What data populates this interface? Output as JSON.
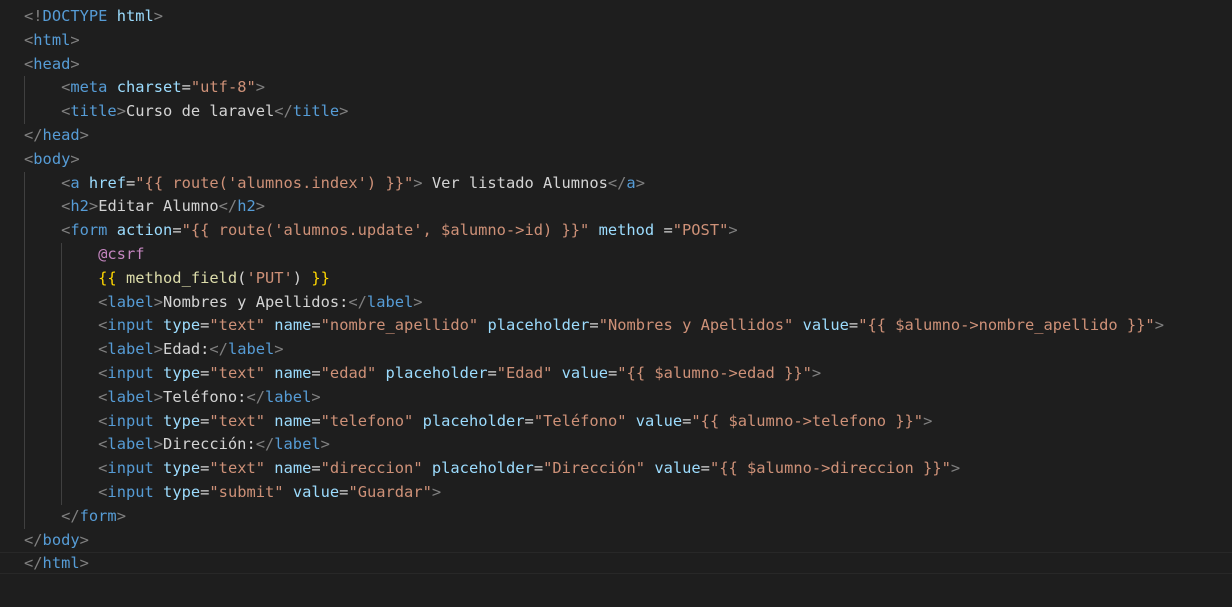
{
  "editor": {
    "background": "#1e1e1e",
    "colors": {
      "punct": "#808080",
      "tag": "#569cd6",
      "attr": "#9cdcfe",
      "string": "#ce9178",
      "text": "#d4d4d4",
      "blade": "#c586c0",
      "brace": "#ffd700",
      "func": "#dcdcaa"
    },
    "lines": [
      {
        "indent": 0,
        "tokens": [
          [
            "punct",
            "<!"
          ],
          [
            "tag",
            "DOCTYPE"
          ],
          [
            "text",
            " "
          ],
          [
            "attr",
            "html"
          ],
          [
            "punct",
            ">"
          ]
        ]
      },
      {
        "indent": 0,
        "tokens": [
          [
            "punct",
            "<"
          ],
          [
            "tag",
            "html"
          ],
          [
            "punct",
            ">"
          ]
        ]
      },
      {
        "indent": 0,
        "tokens": [
          [
            "punct",
            "<"
          ],
          [
            "tag",
            "head"
          ],
          [
            "punct",
            ">"
          ]
        ]
      },
      {
        "indent": 1,
        "tokens": [
          [
            "punct",
            "<"
          ],
          [
            "tag",
            "meta"
          ],
          [
            "text",
            " "
          ],
          [
            "attr",
            "charset"
          ],
          [
            "text",
            "="
          ],
          [
            "str",
            "\"utf-8\""
          ],
          [
            "punct",
            ">"
          ]
        ]
      },
      {
        "indent": 1,
        "tokens": [
          [
            "punct",
            "<"
          ],
          [
            "tag",
            "title"
          ],
          [
            "punct",
            ">"
          ],
          [
            "text",
            "Curso de laravel"
          ],
          [
            "punct",
            "</"
          ],
          [
            "tag",
            "title"
          ],
          [
            "punct",
            ">"
          ]
        ]
      },
      {
        "indent": 0,
        "tokens": [
          [
            "punct",
            "</"
          ],
          [
            "tag",
            "head"
          ],
          [
            "punct",
            ">"
          ]
        ]
      },
      {
        "indent": 0,
        "tokens": [
          [
            "punct",
            "<"
          ],
          [
            "tag",
            "body"
          ],
          [
            "punct",
            ">"
          ]
        ]
      },
      {
        "indent": 1,
        "tokens": [
          [
            "punct",
            "<"
          ],
          [
            "tag",
            "a"
          ],
          [
            "text",
            " "
          ],
          [
            "attr",
            "href"
          ],
          [
            "text",
            "="
          ],
          [
            "str",
            "\"{{ route('alumnos.index') }}\""
          ],
          [
            "punct",
            ">"
          ],
          [
            "text",
            " Ver listado Alumnos"
          ],
          [
            "punct",
            "</"
          ],
          [
            "tag",
            "a"
          ],
          [
            "punct",
            ">"
          ]
        ]
      },
      {
        "indent": 1,
        "tokens": [
          [
            "punct",
            "<"
          ],
          [
            "tag",
            "h2"
          ],
          [
            "punct",
            ">"
          ],
          [
            "text",
            "Editar Alumno"
          ],
          [
            "punct",
            "</"
          ],
          [
            "tag",
            "h2"
          ],
          [
            "punct",
            ">"
          ]
        ]
      },
      {
        "indent": 1,
        "tokens": [
          [
            "punct",
            "<"
          ],
          [
            "tag",
            "form"
          ],
          [
            "text",
            " "
          ],
          [
            "attr",
            "action"
          ],
          [
            "text",
            "="
          ],
          [
            "str",
            "\"{{ route('alumnos.update', $alumno->id) }}\""
          ],
          [
            "text",
            " "
          ],
          [
            "attr",
            "method"
          ],
          [
            "text",
            " ="
          ],
          [
            "str",
            "\"POST\""
          ],
          [
            "punct",
            ">"
          ]
        ]
      },
      {
        "indent": 2,
        "tokens": [
          [
            "blade",
            "@csrf"
          ]
        ]
      },
      {
        "indent": 2,
        "tokens": [
          [
            "brace",
            "{{"
          ],
          [
            "text",
            " "
          ],
          [
            "func",
            "method_field"
          ],
          [
            "text",
            "("
          ],
          [
            "str",
            "'PUT'"
          ],
          [
            "text",
            ") "
          ],
          [
            "brace",
            "}}"
          ]
        ]
      },
      {
        "indent": 2,
        "tokens": [
          [
            "punct",
            "<"
          ],
          [
            "tag",
            "label"
          ],
          [
            "punct",
            ">"
          ],
          [
            "text",
            "Nombres y Apellidos:"
          ],
          [
            "punct",
            "</"
          ],
          [
            "tag",
            "label"
          ],
          [
            "punct",
            ">"
          ]
        ]
      },
      {
        "indent": 2,
        "tokens": [
          [
            "punct",
            "<"
          ],
          [
            "tag",
            "input"
          ],
          [
            "text",
            " "
          ],
          [
            "attr",
            "type"
          ],
          [
            "text",
            "="
          ],
          [
            "str",
            "\"text\""
          ],
          [
            "text",
            " "
          ],
          [
            "attr",
            "name"
          ],
          [
            "text",
            "="
          ],
          [
            "str",
            "\"nombre_apellido\""
          ],
          [
            "text",
            " "
          ],
          [
            "attr",
            "placeholder"
          ],
          [
            "text",
            "="
          ],
          [
            "str",
            "\"Nombres y Apellidos\""
          ],
          [
            "text",
            " "
          ],
          [
            "attr",
            "value"
          ],
          [
            "text",
            "="
          ],
          [
            "str",
            "\"{{ $alumno->nombre_apellido }}\""
          ],
          [
            "punct",
            ">"
          ]
        ]
      },
      {
        "indent": 2,
        "tokens": [
          [
            "punct",
            "<"
          ],
          [
            "tag",
            "label"
          ],
          [
            "punct",
            ">"
          ],
          [
            "text",
            "Edad:"
          ],
          [
            "punct",
            "</"
          ],
          [
            "tag",
            "label"
          ],
          [
            "punct",
            ">"
          ]
        ]
      },
      {
        "indent": 2,
        "tokens": [
          [
            "punct",
            "<"
          ],
          [
            "tag",
            "input"
          ],
          [
            "text",
            " "
          ],
          [
            "attr",
            "type"
          ],
          [
            "text",
            "="
          ],
          [
            "str",
            "\"text\""
          ],
          [
            "text",
            " "
          ],
          [
            "attr",
            "name"
          ],
          [
            "text",
            "="
          ],
          [
            "str",
            "\"edad\""
          ],
          [
            "text",
            " "
          ],
          [
            "attr",
            "placeholder"
          ],
          [
            "text",
            "="
          ],
          [
            "str",
            "\"Edad\""
          ],
          [
            "text",
            " "
          ],
          [
            "attr",
            "value"
          ],
          [
            "text",
            "="
          ],
          [
            "str",
            "\"{{ $alumno->edad }}\""
          ],
          [
            "punct",
            ">"
          ]
        ]
      },
      {
        "indent": 2,
        "tokens": [
          [
            "punct",
            "<"
          ],
          [
            "tag",
            "label"
          ],
          [
            "punct",
            ">"
          ],
          [
            "text",
            "Teléfono:"
          ],
          [
            "punct",
            "</"
          ],
          [
            "tag",
            "label"
          ],
          [
            "punct",
            ">"
          ]
        ]
      },
      {
        "indent": 2,
        "tokens": [
          [
            "punct",
            "<"
          ],
          [
            "tag",
            "input"
          ],
          [
            "text",
            " "
          ],
          [
            "attr",
            "type"
          ],
          [
            "text",
            "="
          ],
          [
            "str",
            "\"text\""
          ],
          [
            "text",
            " "
          ],
          [
            "attr",
            "name"
          ],
          [
            "text",
            "="
          ],
          [
            "str",
            "\"telefono\""
          ],
          [
            "text",
            " "
          ],
          [
            "attr",
            "placeholder"
          ],
          [
            "text",
            "="
          ],
          [
            "str",
            "\"Teléfono\""
          ],
          [
            "text",
            " "
          ],
          [
            "attr",
            "value"
          ],
          [
            "text",
            "="
          ],
          [
            "str",
            "\"{{ $alumno->telefono }}\""
          ],
          [
            "punct",
            ">"
          ]
        ]
      },
      {
        "indent": 2,
        "tokens": [
          [
            "punct",
            "<"
          ],
          [
            "tag",
            "label"
          ],
          [
            "punct",
            ">"
          ],
          [
            "text",
            "Dirección:"
          ],
          [
            "punct",
            "</"
          ],
          [
            "tag",
            "label"
          ],
          [
            "punct",
            ">"
          ]
        ]
      },
      {
        "indent": 2,
        "tokens": [
          [
            "punct",
            "<"
          ],
          [
            "tag",
            "input"
          ],
          [
            "text",
            " "
          ],
          [
            "attr",
            "type"
          ],
          [
            "text",
            "="
          ],
          [
            "str",
            "\"text\""
          ],
          [
            "text",
            " "
          ],
          [
            "attr",
            "name"
          ],
          [
            "text",
            "="
          ],
          [
            "str",
            "\"direccion\""
          ],
          [
            "text",
            " "
          ],
          [
            "attr",
            "placeholder"
          ],
          [
            "text",
            "="
          ],
          [
            "str",
            "\"Dirección\""
          ],
          [
            "text",
            " "
          ],
          [
            "attr",
            "value"
          ],
          [
            "text",
            "="
          ],
          [
            "str",
            "\"{{ $alumno->direccion }}\""
          ],
          [
            "punct",
            ">"
          ]
        ]
      },
      {
        "indent": 2,
        "tokens": [
          [
            "punct",
            "<"
          ],
          [
            "tag",
            "input"
          ],
          [
            "text",
            " "
          ],
          [
            "attr",
            "type"
          ],
          [
            "text",
            "="
          ],
          [
            "str",
            "\"submit\""
          ],
          [
            "text",
            " "
          ],
          [
            "attr",
            "value"
          ],
          [
            "text",
            "="
          ],
          [
            "str",
            "\"Guardar\""
          ],
          [
            "punct",
            ">"
          ]
        ]
      },
      {
        "indent": 1,
        "tokens": [
          [
            "punct",
            "</"
          ],
          [
            "tag",
            "form"
          ],
          [
            "punct",
            ">"
          ]
        ]
      },
      {
        "indent": 0,
        "tokens": [
          [
            "punct",
            "</"
          ],
          [
            "tag",
            "body"
          ],
          [
            "punct",
            ">"
          ]
        ]
      },
      {
        "indent": 0,
        "tokens": [
          [
            "punct",
            "</"
          ],
          [
            "tag",
            "html"
          ],
          [
            "punct",
            ">"
          ]
        ]
      }
    ]
  }
}
